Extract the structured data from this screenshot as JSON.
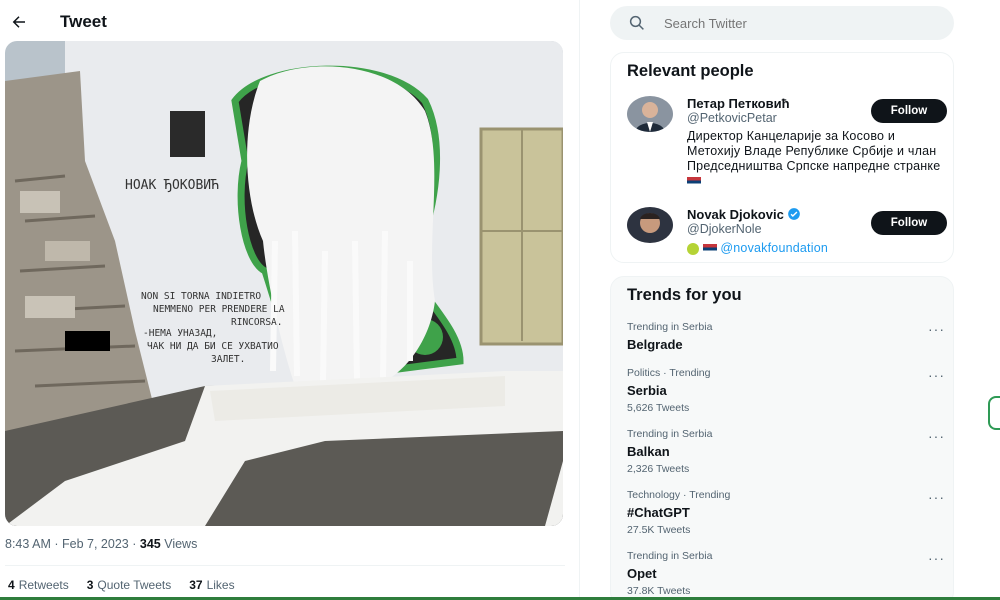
{
  "header": {
    "title": "Tweet"
  },
  "tweet": {
    "photo_alt": "Vandalized mural",
    "wall_text": {
      "signature": "HOAK ЂОКОВИЋ",
      "quote_it_1": "NON SI TORNA INDIETRO",
      "quote_it_2": "NEMMENO PER PRENDERE LA",
      "quote_it_3": "RINCORSA.",
      "quote_sr_1": "-НЕМА УНАЗАД,",
      "quote_sr_2": "ЧАК НИ ДА БИ СЕ УХВАТИО",
      "quote_sr_3": "ЗАЛЕТ."
    },
    "time": "8:43 AM",
    "separator": "·",
    "date": "Feb 7, 2023",
    "views_count": "345",
    "views_label": "Views",
    "retweets_count": "4",
    "retweets_label": "Retweets",
    "quotes_count": "3",
    "quotes_label": "Quote Tweets",
    "likes_count": "37",
    "likes_label": "Likes"
  },
  "search": {
    "placeholder": "Search Twitter"
  },
  "relevant_people": {
    "title": "Relevant people",
    "people": [
      {
        "name": "Петар Петковић",
        "handle": "@PetkovicPetar",
        "bio": "Директор Канцеларије за Косово и Метохију Владе Републике Србије и члан Председништва Српске напредне странке",
        "follow_label": "Follow"
      },
      {
        "name": "Novak Djokovic",
        "handle": "@DjokerNole",
        "bio_link": "@novakfoundation",
        "follow_label": "Follow"
      }
    ]
  },
  "trends": {
    "title": "Trends for you",
    "items": [
      {
        "context": "Trending in Serbia",
        "name": "Belgrade",
        "count": ""
      },
      {
        "context": "Politics · Trending",
        "name": "Serbia",
        "count": "5,626 Tweets"
      },
      {
        "context": "Trending in Serbia",
        "name": "Balkan",
        "count": "2,326 Tweets"
      },
      {
        "context": "Technology · Trending",
        "name": "#ChatGPT",
        "count": "27.5K Tweets"
      },
      {
        "context": "Trending in Serbia",
        "name": "Opet",
        "count": "37.8K Tweets"
      }
    ],
    "more_label": "···"
  },
  "colors": {
    "accent": "#1d9bf0",
    "text": "#0f1419",
    "muted": "#536471",
    "mural_green": "#2e9a55"
  }
}
